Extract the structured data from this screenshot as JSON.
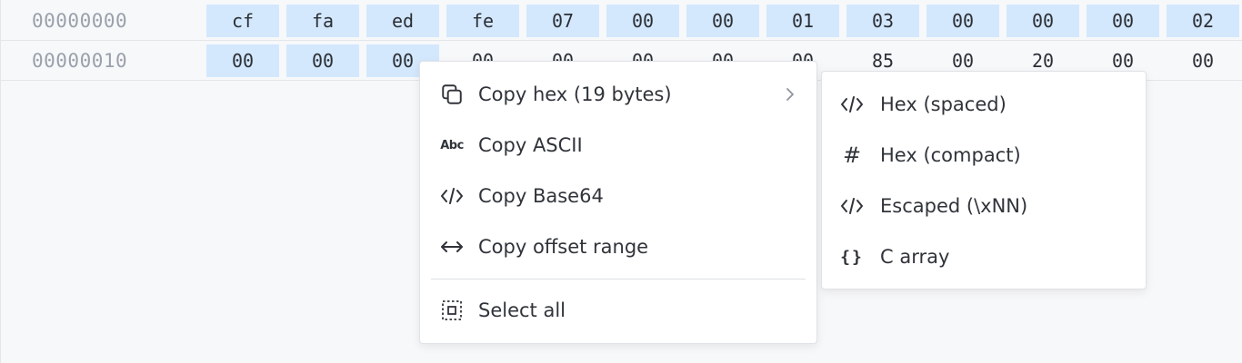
{
  "rows": [
    {
      "offset": "00000000",
      "bytes": [
        "cf",
        "fa",
        "ed",
        "fe",
        "07",
        "00",
        "00",
        "01",
        "03",
        "00",
        "00",
        "00",
        "02"
      ]
    },
    {
      "offset": "00000010",
      "bytes": [
        "00",
        "00",
        "00",
        "00",
        "00",
        "00",
        "00",
        "00",
        "85",
        "00",
        "20",
        "00",
        "00"
      ]
    }
  ],
  "context_menu": {
    "copy_hex": "Copy hex (19 bytes)",
    "copy_ascii": "Copy ASCII",
    "copy_base64": "Copy Base64",
    "copy_offset_range": "Copy offset range",
    "select_all": "Select all",
    "icons": [
      "copy-icon",
      "abc-icon",
      "code-icon",
      "arrows-horizontal-icon",
      "select-all-icon"
    ]
  },
  "submenu": {
    "hex_spaced": "Hex (spaced)",
    "hex_compact": "Hex (compact)",
    "escaped": "Escaped (\\xNN)",
    "c_array": "C array",
    "icons": [
      "code-icon",
      "hash-icon",
      "code-icon",
      "braces-icon"
    ]
  },
  "colors": {
    "selection": "#d3e8fd",
    "background": "#f7f8fa",
    "menu_bg": "#ffffff",
    "text": "#30343a",
    "offset_text": "#9aa1ab"
  }
}
